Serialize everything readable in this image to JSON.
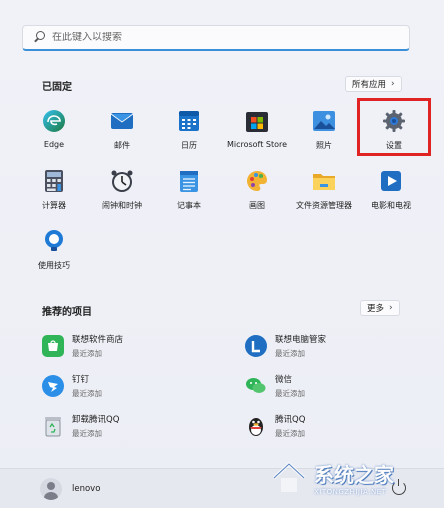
{
  "search": {
    "placeholder": "在此键入以搜索",
    "icon": "search-icon"
  },
  "pinned": {
    "title": "已固定",
    "all_apps_label": "所有应用",
    "apps": [
      {
        "label": "Edge",
        "icon": "edge-icon"
      },
      {
        "label": "邮件",
        "icon": "mail-icon"
      },
      {
        "label": "日历",
        "icon": "calendar-icon"
      },
      {
        "label": "Microsoft Store",
        "icon": "store-icon"
      },
      {
        "label": "照片",
        "icon": "photos-icon"
      },
      {
        "label": "设置",
        "icon": "settings-gear-icon"
      },
      {
        "label": "计算器",
        "icon": "calculator-icon"
      },
      {
        "label": "闹钟和时钟",
        "icon": "alarm-clock-icon"
      },
      {
        "label": "记事本",
        "icon": "notepad-icon"
      },
      {
        "label": "画图",
        "icon": "paint-icon"
      },
      {
        "label": "文件资源管理器",
        "icon": "file-explorer-icon"
      },
      {
        "label": "电影和电视",
        "icon": "movies-tv-icon"
      },
      {
        "label": "使用技巧",
        "icon": "tips-icon"
      }
    ]
  },
  "recommended": {
    "title": "推荐的项目",
    "more_label": "更多",
    "items": [
      {
        "name": "联想软件商店",
        "sub": "最近添加",
        "icon": "lenovo-store-icon"
      },
      {
        "name": "联想电脑管家",
        "sub": "最近添加",
        "icon": "lenovo-manager-icon"
      },
      {
        "name": "钉钉",
        "sub": "最近添加",
        "icon": "dingtalk-icon"
      },
      {
        "name": "微信",
        "sub": "最近添加",
        "icon": "wechat-icon"
      },
      {
        "name": "卸载腾讯QQ",
        "sub": "最近添加",
        "icon": "recycle-bin-icon"
      },
      {
        "name": "腾讯QQ",
        "sub": "最近添加",
        "icon": "qq-penguin-icon"
      }
    ]
  },
  "user": {
    "name": "lenovo"
  },
  "watermark": {
    "title": "系统之家",
    "url": "XITONGZHIJIA.NET"
  }
}
